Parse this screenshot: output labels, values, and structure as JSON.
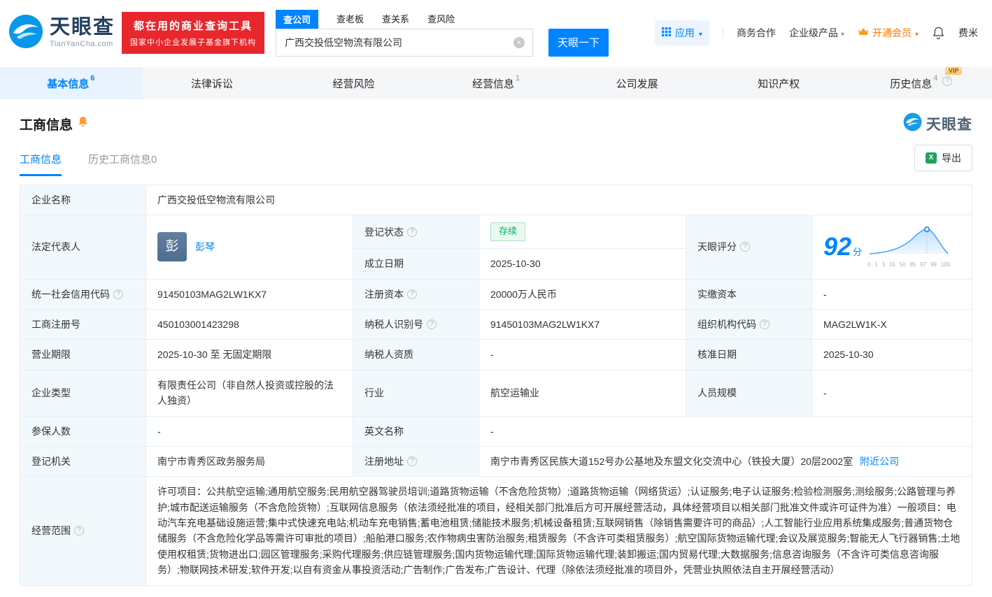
{
  "brand": {
    "name": "天眼查",
    "domain": "TianYanCha.com",
    "slogan_line1": "都在用的商业查询工具",
    "slogan_line2": "国家中小企业发展子基金旗下机构",
    "colors": {
      "primary": "#0084ff",
      "banner_red": "#e7272d",
      "vip_orange": "#ff7a00",
      "status_green": "#00b05a"
    }
  },
  "header": {
    "search_tabs": [
      {
        "label": "查公司"
      },
      {
        "label": "查老板"
      },
      {
        "label": "查关系"
      },
      {
        "label": "查风险"
      }
    ],
    "search_value": "广西交投低空物流有限公司",
    "search_button": "天眼一下",
    "menu": {
      "apps": "应用",
      "cooperation": "商务合作",
      "enterprise": "企业级产品",
      "vip": "开通会员",
      "user": "费米"
    }
  },
  "nav": {
    "vip_badge": "VIP",
    "tabs": [
      {
        "label": "基本信息",
        "count": "6"
      },
      {
        "label": "法律诉讼",
        "count": ""
      },
      {
        "label": "经营风险",
        "count": ""
      },
      {
        "label": "经营信息",
        "count": "1"
      },
      {
        "label": "公司发展",
        "count": ""
      },
      {
        "label": "知识产权",
        "count": ""
      },
      {
        "label": "历史信息",
        "count": "4"
      }
    ]
  },
  "section": {
    "title": "工商信息",
    "logo_watermark": "天眼查",
    "tab_current": "工商信息",
    "tab_history": "历史工商信息0",
    "export": "导出"
  },
  "info": {
    "company_name": {
      "label": "企业名称",
      "value": "广西交投低空物流有限公司"
    },
    "legal_rep": {
      "label": "法定代表人",
      "avatar": "彭",
      "name": "彭琴"
    },
    "reg_status": {
      "label": "登记状态",
      "value": "存续"
    },
    "score": {
      "label": "天眼评分",
      "value": "92",
      "unit": "分"
    },
    "est_date": {
      "label": "成立日期",
      "value": "2025-10-30"
    },
    "credit_code": {
      "label": "统一社会信用代码",
      "value": "91450103MAG2LW1KX7"
    },
    "reg_capital": {
      "label": "注册资本",
      "value": "20000万人民币"
    },
    "paid_capital": {
      "label": "实缴资本",
      "value": "-"
    },
    "reg_number": {
      "label": "工商注册号",
      "value": "450103001423298"
    },
    "taxpayer_id": {
      "label": "纳税人识别号",
      "value": "91450103MAG2LW1KX7"
    },
    "org_code": {
      "label": "组织机构代码",
      "value": "MAG2LW1K-X"
    },
    "business_term": {
      "label": "营业期限",
      "value": "2025-10-30 至 无固定期限"
    },
    "taxpayer_qual": {
      "label": "纳税人资质",
      "value": "-"
    },
    "approval_date": {
      "label": "核准日期",
      "value": "2025-10-30"
    },
    "company_type": {
      "label": "企业类型",
      "value": "有限责任公司（非自然人投资或控股的法人独资）"
    },
    "industry": {
      "label": "行业",
      "value": "航空运输业"
    },
    "staff_size": {
      "label": "人员规模",
      "value": "-"
    },
    "insured_count": {
      "label": "参保人数",
      "value": "-"
    },
    "english_name": {
      "label": "英文名称",
      "value": "-"
    },
    "reg_authority": {
      "label": "登记机关",
      "value": "南宁市青秀区政务服务局"
    },
    "reg_address": {
      "label": "注册地址",
      "value": "南宁市青秀区民族大道152号办公基地及东盟文化交流中心（铁投大厦）20层2002室",
      "link": "附近公司"
    },
    "business_scope": {
      "label": "经营范围",
      "value": "许可项目：公共航空运输;通用航空服务;民用航空器驾驶员培训;道路货物运输（不含危险货物）;道路货物运输（网络货运）;认证服务;电子认证服务;检验检测服务;测绘服务;公路管理与养护;城市配送运输服务（不含危险货物）;互联网信息服务（依法须经批准的项目，经相关部门批准后方可开展经营活动，具体经营项目以相关部门批准文件或许可证件为准）一般项目：电动汽车充电基础设施运营;集中式快速充电站;机动车充电销售;蓄电池租赁;储能技术服务;机械设备租赁;互联网销售（除销售需要许可的商品）;人工智能行业应用系统集成服务;普通货物仓储服务（不含危险化学品等需许可审批的项目）;船舶港口服务;农作物病虫害防治服务;租赁服务（不含许可类租赁服务）;航空国际货物运输代理;会议及展览服务;智能无人飞行器销售;土地使用权租赁;货物进出口;园区管理服务;采购代理服务;供应链管理服务;国内货物运输代理;国际货物运输代理;装卸搬运;国内贸易代理;大数据服务;信息咨询服务（不含许可类信息咨询服务）;物联网技术研发;软件开发;以自有资金从事投资活动;广告制作;广告发布;广告设计、代理（除依法须经批准的项目外，凭营业执照依法自主开展经营活动）"
    }
  },
  "score_axis": [
    "0",
    "1",
    "3",
    "15",
    "50",
    "85",
    "97",
    "99",
    "100"
  ]
}
